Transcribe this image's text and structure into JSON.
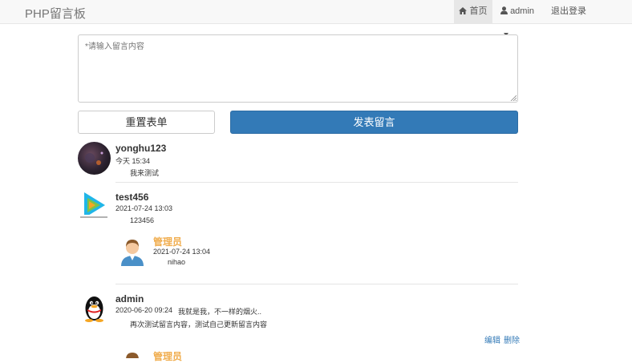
{
  "navbar": {
    "brand": "PHP留言板",
    "home_label": "首页",
    "user_label": "admin",
    "logout_label": "退出登录"
  },
  "composer": {
    "placeholder": "*请输入留言内容",
    "reset_label": "重置表单",
    "submit_label": "发表留言"
  },
  "messages": [
    {
      "user": "yonghu123",
      "time": "今天 15:34",
      "content": "我来测试"
    },
    {
      "user": "test456",
      "time": "2021-07-24 13:03",
      "content": "123456",
      "reply": {
        "user": "管理员",
        "time": "2021-07-24 13:04",
        "content": "nihao"
      }
    },
    {
      "user": "admin",
      "time": "2020-06-20 09:24",
      "signature": "我就是我，不一样的烟火..",
      "content": "再次测试留言内容，测试自己更新留言内容",
      "actions": {
        "edit": "编辑",
        "delete": "删除"
      },
      "reply": {
        "user": "管理员"
      }
    }
  ]
}
